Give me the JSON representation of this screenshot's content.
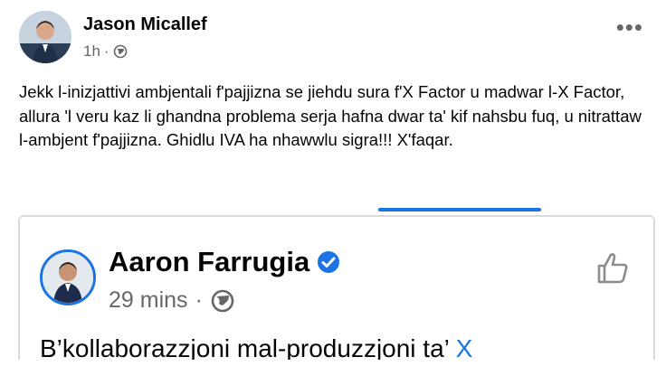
{
  "post": {
    "author": "Jason Micallef",
    "time": "1h",
    "privacy_icon": "globe-icon",
    "menu_icon": "more-options-icon",
    "text": "Jekk l-inizjattivi ambjentali f'pajjizna se jiehdu sura f'X Factor u madwar l-X Factor, allura 'l veru kaz li ghandna problema serja hafna dwar ta' kif nahsbu fuq, u nitrattaw l-ambjent f'pajjizna. Ghidlu IVA ha nhawwlu sigra!!! X'faqar."
  },
  "embedded_post": {
    "author": "Aaron Farrugia",
    "verified_icon": "verified-badge-icon",
    "time": "29 mins",
    "separator": "·",
    "privacy_icon": "globe-icon",
    "like_icon": "thumbs-up-icon",
    "text_start": "B’kollaborazzjoni mal-produzzjoni ta’ ",
    "text_link": "X"
  },
  "colors": {
    "accent": "#1b74e4",
    "secondary_text": "#65676b",
    "border": "#d7dadf"
  }
}
